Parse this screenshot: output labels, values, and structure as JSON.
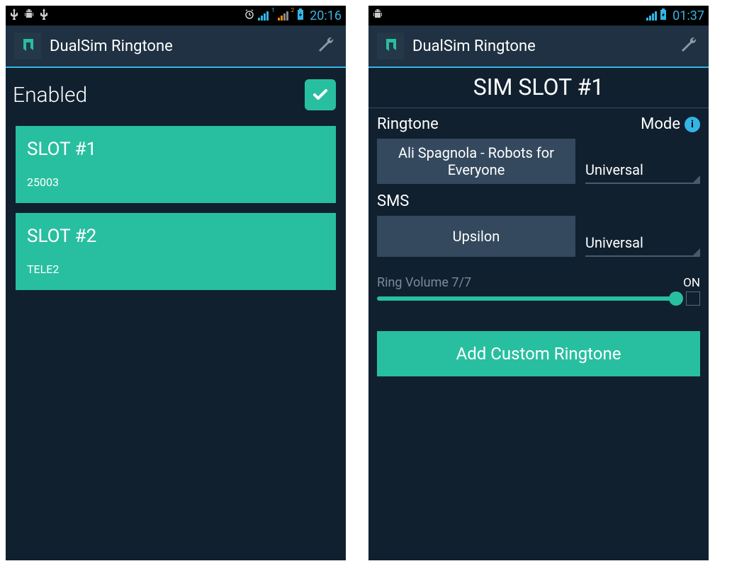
{
  "screen1": {
    "status": {
      "time": "20:16"
    },
    "app_title": "DualSim Ringtone",
    "enabled_label": "Enabled",
    "slots": [
      {
        "title": "SLOT #1",
        "sub": "25003"
      },
      {
        "title": "SLOT #2",
        "sub": "TELE2"
      }
    ]
  },
  "screen2": {
    "status": {
      "time": "01:37"
    },
    "app_title": "DualSim Ringtone",
    "header": "SIM SLOT #1",
    "ringtone_label": "Ringtone",
    "mode_label": "Mode",
    "ringtone_value": "Ali Spagnola - Robots for Everyone",
    "ringtone_mode": "Universal",
    "sms_label": "SMS",
    "sms_value": "Upsilon",
    "sms_mode": "Universal",
    "volume_label": "Ring Volume 7/7",
    "on_label": "ON",
    "add_button": "Add Custom Ringtone"
  }
}
